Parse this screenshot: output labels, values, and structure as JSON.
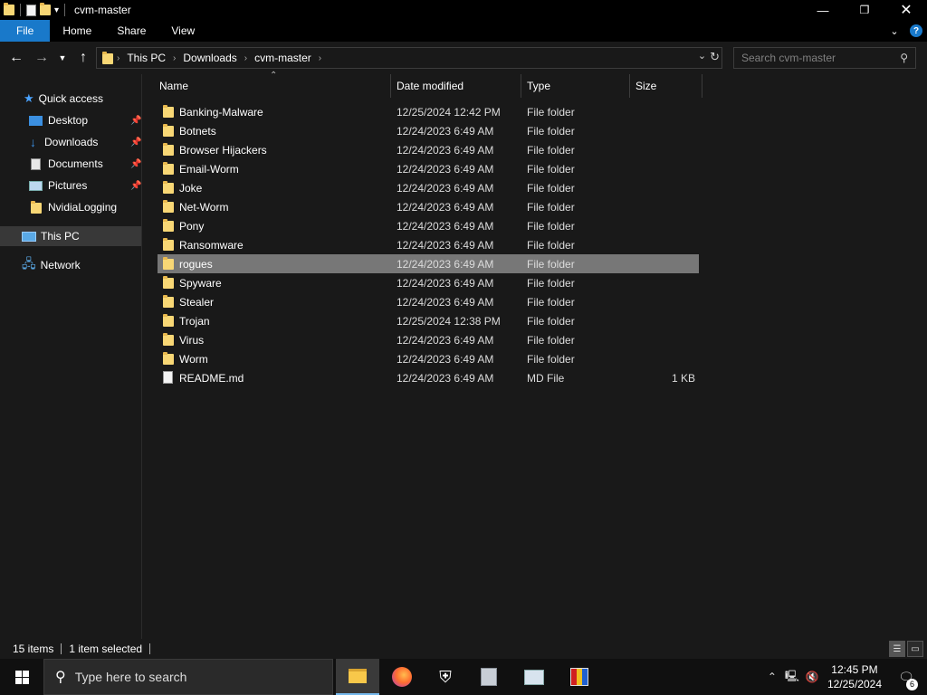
{
  "window": {
    "title": "cvm-master"
  },
  "ribbon": {
    "tabs": [
      "File",
      "Home",
      "Share",
      "View"
    ]
  },
  "address": {
    "crumbs": [
      "This PC",
      "Downloads",
      "cvm-master"
    ]
  },
  "search": {
    "placeholder": "Search cvm-master"
  },
  "navpane": {
    "quick_access": "Quick access",
    "pinned": [
      "Desktop",
      "Downloads",
      "Documents",
      "Pictures"
    ],
    "other": "NvidiaLogging",
    "this_pc": "This PC",
    "network": "Network"
  },
  "columns": {
    "name": "Name",
    "date": "Date modified",
    "type": "Type",
    "size": "Size"
  },
  "files": [
    {
      "name": "Banking-Malware",
      "date": "12/25/2024 12:42 PM",
      "type": "File folder",
      "size": ""
    },
    {
      "name": "Botnets",
      "date": "12/24/2023 6:49 AM",
      "type": "File folder",
      "size": ""
    },
    {
      "name": "Browser Hijackers",
      "date": "12/24/2023 6:49 AM",
      "type": "File folder",
      "size": ""
    },
    {
      "name": "Email-Worm",
      "date": "12/24/2023 6:49 AM",
      "type": "File folder",
      "size": ""
    },
    {
      "name": "Joke",
      "date": "12/24/2023 6:49 AM",
      "type": "File folder",
      "size": ""
    },
    {
      "name": "Net-Worm",
      "date": "12/24/2023 6:49 AM",
      "type": "File folder",
      "size": ""
    },
    {
      "name": "Pony",
      "date": "12/24/2023 6:49 AM",
      "type": "File folder",
      "size": ""
    },
    {
      "name": "Ransomware",
      "date": "12/24/2023 6:49 AM",
      "type": "File folder",
      "size": ""
    },
    {
      "name": "rogues",
      "date": "12/24/2023 6:49 AM",
      "type": "File folder",
      "size": ""
    },
    {
      "name": "Spyware",
      "date": "12/24/2023 6:49 AM",
      "type": "File folder",
      "size": ""
    },
    {
      "name": "Stealer",
      "date": "12/24/2023 6:49 AM",
      "type": "File folder",
      "size": ""
    },
    {
      "name": "Trojan",
      "date": "12/25/2024 12:38 PM",
      "type": "File folder",
      "size": ""
    },
    {
      "name": "Virus",
      "date": "12/24/2023 6:49 AM",
      "type": "File folder",
      "size": ""
    },
    {
      "name": "Worm",
      "date": "12/24/2023 6:49 AM",
      "type": "File folder",
      "size": ""
    },
    {
      "name": "README.md",
      "date": "12/24/2023 6:49 AM",
      "type": "MD File",
      "size": "1 KB"
    }
  ],
  "selected_index": 8,
  "status": {
    "count": "15 items",
    "selected": "1 item selected"
  },
  "taskbar": {
    "search_placeholder": "Type here to search",
    "time": "12:45 PM",
    "date": "12/25/2024",
    "notifications": "6"
  },
  "colors": {
    "accent": "#1979ca",
    "folder": "#f8d775",
    "selection": "#777777",
    "background": "#191919"
  }
}
